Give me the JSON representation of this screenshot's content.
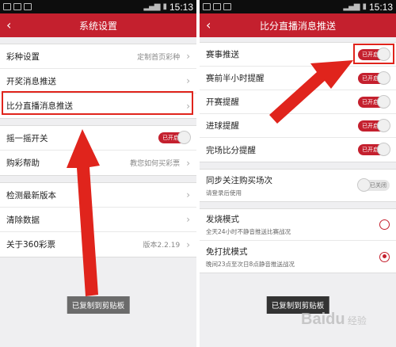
{
  "status": {
    "time": "15:13"
  },
  "left": {
    "title": "系统设置",
    "group1": [
      {
        "label": "彩种设置",
        "value": "定制首页彩种"
      },
      {
        "label": "开奖消息推送",
        "value": ""
      },
      {
        "label": "比分直播消息推送",
        "value": ""
      }
    ],
    "group2": [
      {
        "label": "摇一摇开关",
        "toggle": "已开启"
      },
      {
        "label": "购彩帮助",
        "value": "教您如何买彩票"
      }
    ],
    "group3": [
      {
        "label": "检测最新版本",
        "value": ""
      },
      {
        "label": "清除数据",
        "value": ""
      },
      {
        "label": "关于360彩票",
        "value": "版本2.2.19"
      }
    ],
    "toast": "已复制到剪贴板"
  },
  "right": {
    "title": "比分直播消息推送",
    "group1": [
      {
        "label": "赛事推送",
        "toggle": "已开启"
      },
      {
        "label": "赛前半小时提醒",
        "toggle": "已开启"
      },
      {
        "label": "开赛提醒",
        "toggle": "已开启"
      },
      {
        "label": "进球提醒",
        "toggle": "已开启"
      },
      {
        "label": "完场比分提醒",
        "toggle": "已开启"
      }
    ],
    "sync": {
      "label": "同步关注购买场次",
      "sub": "请登录后使用",
      "toggle": "已关闭"
    },
    "mode1": {
      "label": "发烧模式",
      "sub": "全天24小时不静音推送比赛战况"
    },
    "mode2": {
      "label": "免打扰模式",
      "sub": "晚间23点至次日8点静音推送战况"
    },
    "toast": "已复制到剪贴板"
  },
  "colors": {
    "accent": "#c4202e",
    "annotation": "#e0241c"
  },
  "icons": {
    "back": "chevron-left-icon",
    "row": "chevron-right-icon"
  }
}
